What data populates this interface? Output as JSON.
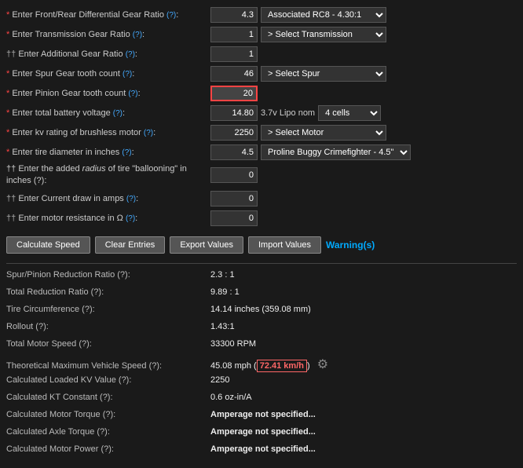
{
  "form": {
    "rows": [
      {
        "id": "front-rear-diff",
        "required": true,
        "label": "Enter Front/Rear Differential Gear Ratio",
        "help": "(?)",
        "value": "4.3",
        "dropdown": "Associated RC8 - 4.30:1",
        "has_dropdown": true
      },
      {
        "id": "transmission-gear-ratio",
        "required": true,
        "label": "Enter Transmission Gear Ratio",
        "help": "(?)",
        "value": "1",
        "dropdown": "> Select Transmission",
        "has_dropdown": true
      },
      {
        "id": "additional-gear-ratio",
        "required": false,
        "optional": true,
        "label": "Enter Additional Gear Ratio",
        "help": "(?)",
        "value": "1",
        "has_dropdown": false
      },
      {
        "id": "spur-gear-tooth",
        "required": true,
        "label": "Enter Spur Gear tooth count",
        "help": "(?)",
        "value": "46",
        "dropdown": "> Select Spur",
        "has_dropdown": true
      },
      {
        "id": "pinion-gear-tooth",
        "required": true,
        "label": "Enter Pinion Gear tooth count",
        "help": "(?)",
        "value": "20",
        "highlighted": true,
        "has_dropdown": false
      },
      {
        "id": "total-battery-voltage",
        "required": false,
        "optional": false,
        "required_star": true,
        "label": "Enter total battery voltage",
        "help": "(?)",
        "value": "14.80",
        "inline_label": "3.7v Lipo nom",
        "inline_dropdown": "4 cells",
        "has_dropdown": true,
        "has_inline": true
      },
      {
        "id": "kv-rating",
        "required": true,
        "label": "Enter kv rating of brushless motor",
        "help": "(?)",
        "value": "2250",
        "dropdown": "> Select Motor",
        "has_dropdown": true
      },
      {
        "id": "tire-diameter",
        "required": true,
        "label": "Enter tire diameter in inches",
        "help": "(?)",
        "value": "4.5",
        "dropdown": "Proline Buggy Crimefighter - 4.5\"",
        "has_dropdown": true
      },
      {
        "id": "tire-ballooning",
        "required": false,
        "optional": true,
        "label": "Enter the added radius of tire \"ballooning\" in inches",
        "help": "(?)",
        "value": "0",
        "has_dropdown": false,
        "multiline": true
      },
      {
        "id": "current-draw",
        "required": false,
        "optional": true,
        "label": "Enter Current draw in amps",
        "help": "(?)",
        "value": "0",
        "has_dropdown": false
      },
      {
        "id": "motor-resistance",
        "required": false,
        "optional": true,
        "label": "Enter motor resistance in Ω",
        "help": "(?)",
        "value": "0",
        "has_dropdown": false
      }
    ]
  },
  "buttons": {
    "calculate": "Calculate Speed",
    "clear": "Clear Entries",
    "export": "Export Values",
    "import": "Import Values",
    "warnings": "Warning(s)"
  },
  "results": {
    "rows": [
      {
        "id": "spur-pinion-reduction",
        "label": "Spur/Pinion Reduction Ratio (?)",
        "value": "2.3 : 1",
        "bold": false
      },
      {
        "id": "total-reduction",
        "label": "Total Reduction Ratio (?)",
        "value": "9.89 : 1",
        "bold": false
      },
      {
        "id": "tire-circumference",
        "label": "Tire Circumference (?)",
        "value": "14.14 inches (359.08 mm)",
        "bold": false
      },
      {
        "id": "rollout",
        "label": "Rollout (?)",
        "value": "1.43:1",
        "bold": false
      },
      {
        "id": "total-motor-speed",
        "label": "Total Motor Speed (?)",
        "value": "33300 RPM",
        "bold": false
      },
      {
        "id": "theoretical-max-speed",
        "label": "Theoretical Maximum Vehicle Speed (?)",
        "value_mph": "45.08 mph",
        "value_kmh": "72.41 km/h",
        "bold": false,
        "has_gear": true,
        "special": true
      },
      {
        "id": "calculated-loaded-kv",
        "label": "Calculated Loaded KV Value (?)",
        "value": "2250",
        "bold": false
      },
      {
        "id": "calculated-kt-constant",
        "label": "Calculated KT Constant (?)",
        "value": "0.6 oz-in/A",
        "bold": false
      },
      {
        "id": "calculated-motor-torque",
        "label": "Calculated Motor Torque (?)",
        "value": "Amperage not specified...",
        "bold": true
      },
      {
        "id": "calculated-axle-torque",
        "label": "Calculated Axle Torque (?)",
        "value": "Amperage not specified...",
        "bold": true
      },
      {
        "id": "calculated-motor-power",
        "label": "Calculated Motor Power (?)",
        "value": "Amperage not specified...",
        "bold": true
      }
    ]
  }
}
